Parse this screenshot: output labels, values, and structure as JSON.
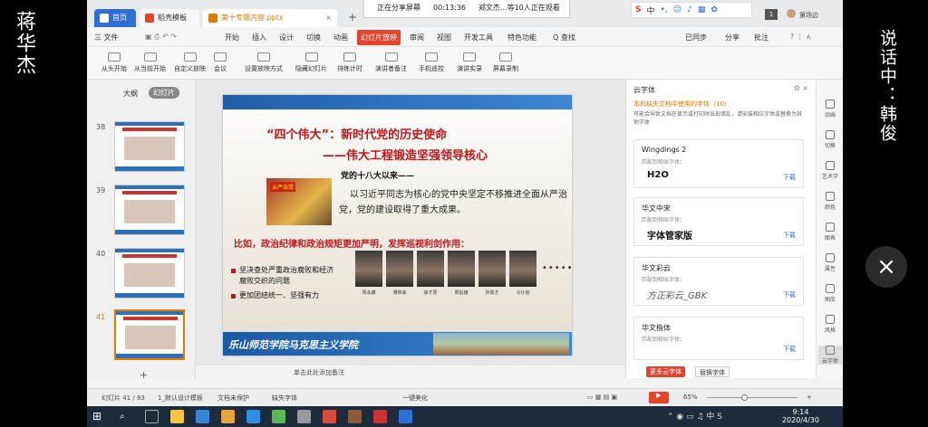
{
  "left_caption": "蒋华杰",
  "right_caption": "说话中：韩俊",
  "share": {
    "status": "正在分享屏幕",
    "time": "00:13:36",
    "watching": "郑文杰...等10人正在观看"
  },
  "tabs": [
    {
      "label": "首页",
      "color": "#2f6fd4"
    },
    {
      "label": "稻壳模板",
      "color": "#e4432d"
    },
    {
      "label": "第十专题内容.pptx",
      "color": "#e07b00"
    }
  ],
  "menus": [
    "三 文件",
    "开始",
    "插入",
    "设计",
    "切换",
    "动画",
    "幻灯片放映",
    "审阅",
    "视图",
    "开发工具",
    "特色功能",
    "Q 查找"
  ],
  "menu_right": [
    "已同步",
    "分享",
    "批注"
  ],
  "user_name": "第场边",
  "toolbar": [
    "从头开始",
    "从当前开始",
    "自定义放映",
    "会议",
    "设置放映方式",
    "隐藏幻灯片",
    "排练计时",
    "演讲者备注",
    "手机遥控",
    "演讲实录",
    "屏幕录制"
  ],
  "left_pane": {
    "tab_outline": "大纲",
    "tab_slides": "幻灯片",
    "numbers": [
      "38",
      "39",
      "40",
      "41"
    ]
  },
  "slide": {
    "title1": "“四个伟大”：新时代党的历史使命",
    "title2": "——伟大工程锻造坚强领导核心",
    "sub": "党的十八大以来——",
    "img_badge": "从严治党",
    "para": "以习近平同志为核心的党中央坚定不移推进全面从严治党，党的建设取得了重大成果。",
    "red": "比如，政治纪律和政治规矩更加严明，发挥巡视利剑作用：",
    "bullets": [
      "坚决查处严重政治腐败和经济腐败交织的问题",
      "更加团结统一、坚强有力"
    ],
    "names": [
      "周永康",
      "薄熙来",
      "徐才厚",
      "郭伯雄",
      "孙政才",
      "令计划"
    ],
    "dots": "•••••••",
    "footer": "乐山师范学院马克思主义学院"
  },
  "notes": "单击此处添加备注",
  "font_panel": {
    "title": "云字体",
    "warning": "本机缺失文档中使用的字体（10）",
    "desc": "可能会导致文档在显示或打印时出现错乱，请安装相应字体或替换为其他字体",
    "fonts": [
      {
        "name": "Wingdings 2",
        "sub": "匹配到相似字体：",
        "preview": "H2O",
        "action": "下载"
      },
      {
        "name": "华文中宋",
        "sub": "匹配到相似字体：",
        "preview": "字体管家版",
        "action": "下载"
      },
      {
        "name": "华文彩云",
        "sub": "匹配到相似字体：",
        "preview": "方正彩云_GBK",
        "action": "下载"
      },
      {
        "name": "华文楷体",
        "sub": "匹配到相似字体：",
        "preview": "",
        "action": "下载"
      }
    ],
    "more_btn": "更多云字体",
    "replace_btn": "替换字体"
  },
  "sidebar": [
    "动画",
    "切换",
    "艺术字",
    "颜色",
    "图表",
    "属性",
    "图库",
    "风格",
    "云字体"
  ],
  "status": {
    "slide": "幻灯片 41 / 83",
    "template": "1_默认设计模板",
    "protect": "文档未保护",
    "missing": "缺失字体",
    "beautify": "一键美化",
    "zoom": "65%"
  },
  "clock": {
    "time": "9:14",
    "date": "2020/4/30"
  }
}
